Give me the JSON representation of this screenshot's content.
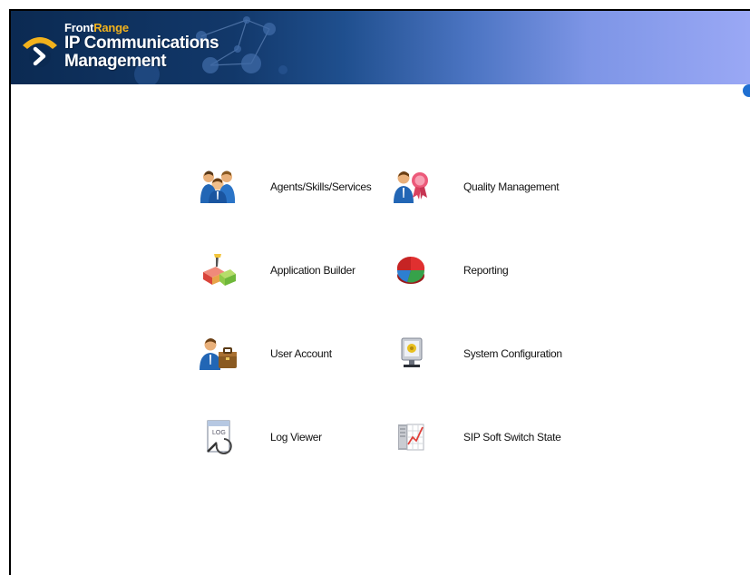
{
  "header": {
    "brand_front": "Front",
    "brand_range": "Range",
    "product_line1": "IP Communications",
    "product_line2": "Management"
  },
  "menu": {
    "agents": "Agents/Skills/Services",
    "quality": "Quality Management",
    "app_builder": "Application Builder",
    "reporting": "Reporting",
    "user_account": "User Account",
    "system_config": "System Configuration",
    "log_viewer": "Log Viewer",
    "sip_state": "SIP Soft Switch State"
  },
  "icons": {
    "agents": "agents-group-icon",
    "quality": "quality-award-icon",
    "app_builder": "application-builder-icon",
    "reporting": "pie-chart-icon",
    "user_account": "user-briefcase-icon",
    "system_config": "monitor-config-icon",
    "log_viewer": "log-document-icon",
    "sip_state": "switch-graph-icon",
    "help": "help-icon"
  },
  "colors": {
    "banner_dark": "#0b2a52",
    "banner_light": "#9aa8f5",
    "brand_accent": "#f2b21c"
  }
}
